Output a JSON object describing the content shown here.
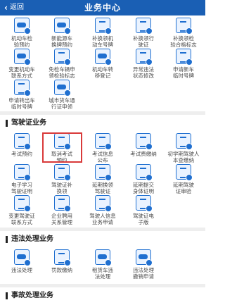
{
  "header": {
    "back_label": "返回",
    "title": "业务中心"
  },
  "top_grid": {
    "row1": [
      {
        "label": "机动车检\n验预约",
        "icon": "car-inspection-icon"
      },
      {
        "label": "新能源车\n换牌预约",
        "icon": "new-energy-plate-icon"
      },
      {
        "label": "补换领机\n动车号牌",
        "icon": "plate-replacement-icon"
      },
      {
        "label": "补换领行\n驶证",
        "icon": "driving-permit-icon"
      },
      {
        "label": "补换领检\n验合格标志",
        "icon": "inspection-mark-icon"
      }
    ],
    "row2": [
      {
        "label": "变更机动车\n联系方式",
        "icon": "contact-change-icon"
      },
      {
        "label": "免检车辆申\n领检验标志",
        "icon": "exempt-mark-icon"
      },
      {
        "label": "机动车转\n移登记",
        "icon": "transfer-icon"
      },
      {
        "label": "异常违法\n状态修改",
        "icon": "status-edit-icon"
      },
      {
        "label": "申请新车\n临时号牌",
        "icon": "temp-plate-icon"
      }
    ],
    "row3": [
      {
        "label": "申请转出车\n临时号牌",
        "icon": "transfer-temp-plate-icon"
      },
      {
        "label": "城市货车通\n行证申领",
        "icon": "truck-pass-icon"
      }
    ]
  },
  "license_section": {
    "title": "驾驶证业务",
    "row1": [
      {
        "label": "考试预约",
        "icon": "exam-booking-icon"
      },
      {
        "label": "取消考试\n预约",
        "icon": "cancel-exam-icon"
      },
      {
        "label": "考试信息\n公布",
        "icon": "exam-info-icon"
      },
      {
        "label": "考试费缴纳",
        "icon": "exam-fee-icon"
      },
      {
        "label": "初学期驾驶人\n本查缴纳",
        "icon": "learner-icon"
      }
    ],
    "row2": [
      {
        "label": "电子学习\n驾驶证明",
        "icon": "e-learning-cert-icon"
      },
      {
        "label": "驾驶证补\n换领",
        "icon": "license-replace-icon"
      },
      {
        "label": "延期换领\n驾驶证",
        "icon": "extend-license-icon"
      },
      {
        "label": "延期提交\n身体证明",
        "icon": "health-cert-icon"
      },
      {
        "label": "延期驾驶\n证审验",
        "icon": "license-audit-icon"
      }
    ],
    "row3": [
      {
        "label": "变更驾驶证\n联系方式",
        "icon": "license-contact-icon"
      },
      {
        "label": "企业聘用\n关系管理",
        "icon": "employment-icon"
      },
      {
        "label": "驾驶人信息\n业务申请",
        "icon": "driver-info-icon"
      },
      {
        "label": "驾驶证电\n子版",
        "icon": "e-license-icon"
      }
    ]
  },
  "violation_section": {
    "title": "违法处理业务",
    "row1": [
      {
        "label": "违法处理",
        "icon": "violation-icon"
      },
      {
        "label": "罚款缴纳",
        "icon": "fine-payment-icon"
      },
      {
        "label": "租赁车违\n法处理",
        "icon": "rental-violation-icon"
      },
      {
        "label": "违法处理\n撤销申请",
        "icon": "revoke-icon"
      }
    ]
  },
  "accident_section": {
    "title": "事故处理业务"
  }
}
